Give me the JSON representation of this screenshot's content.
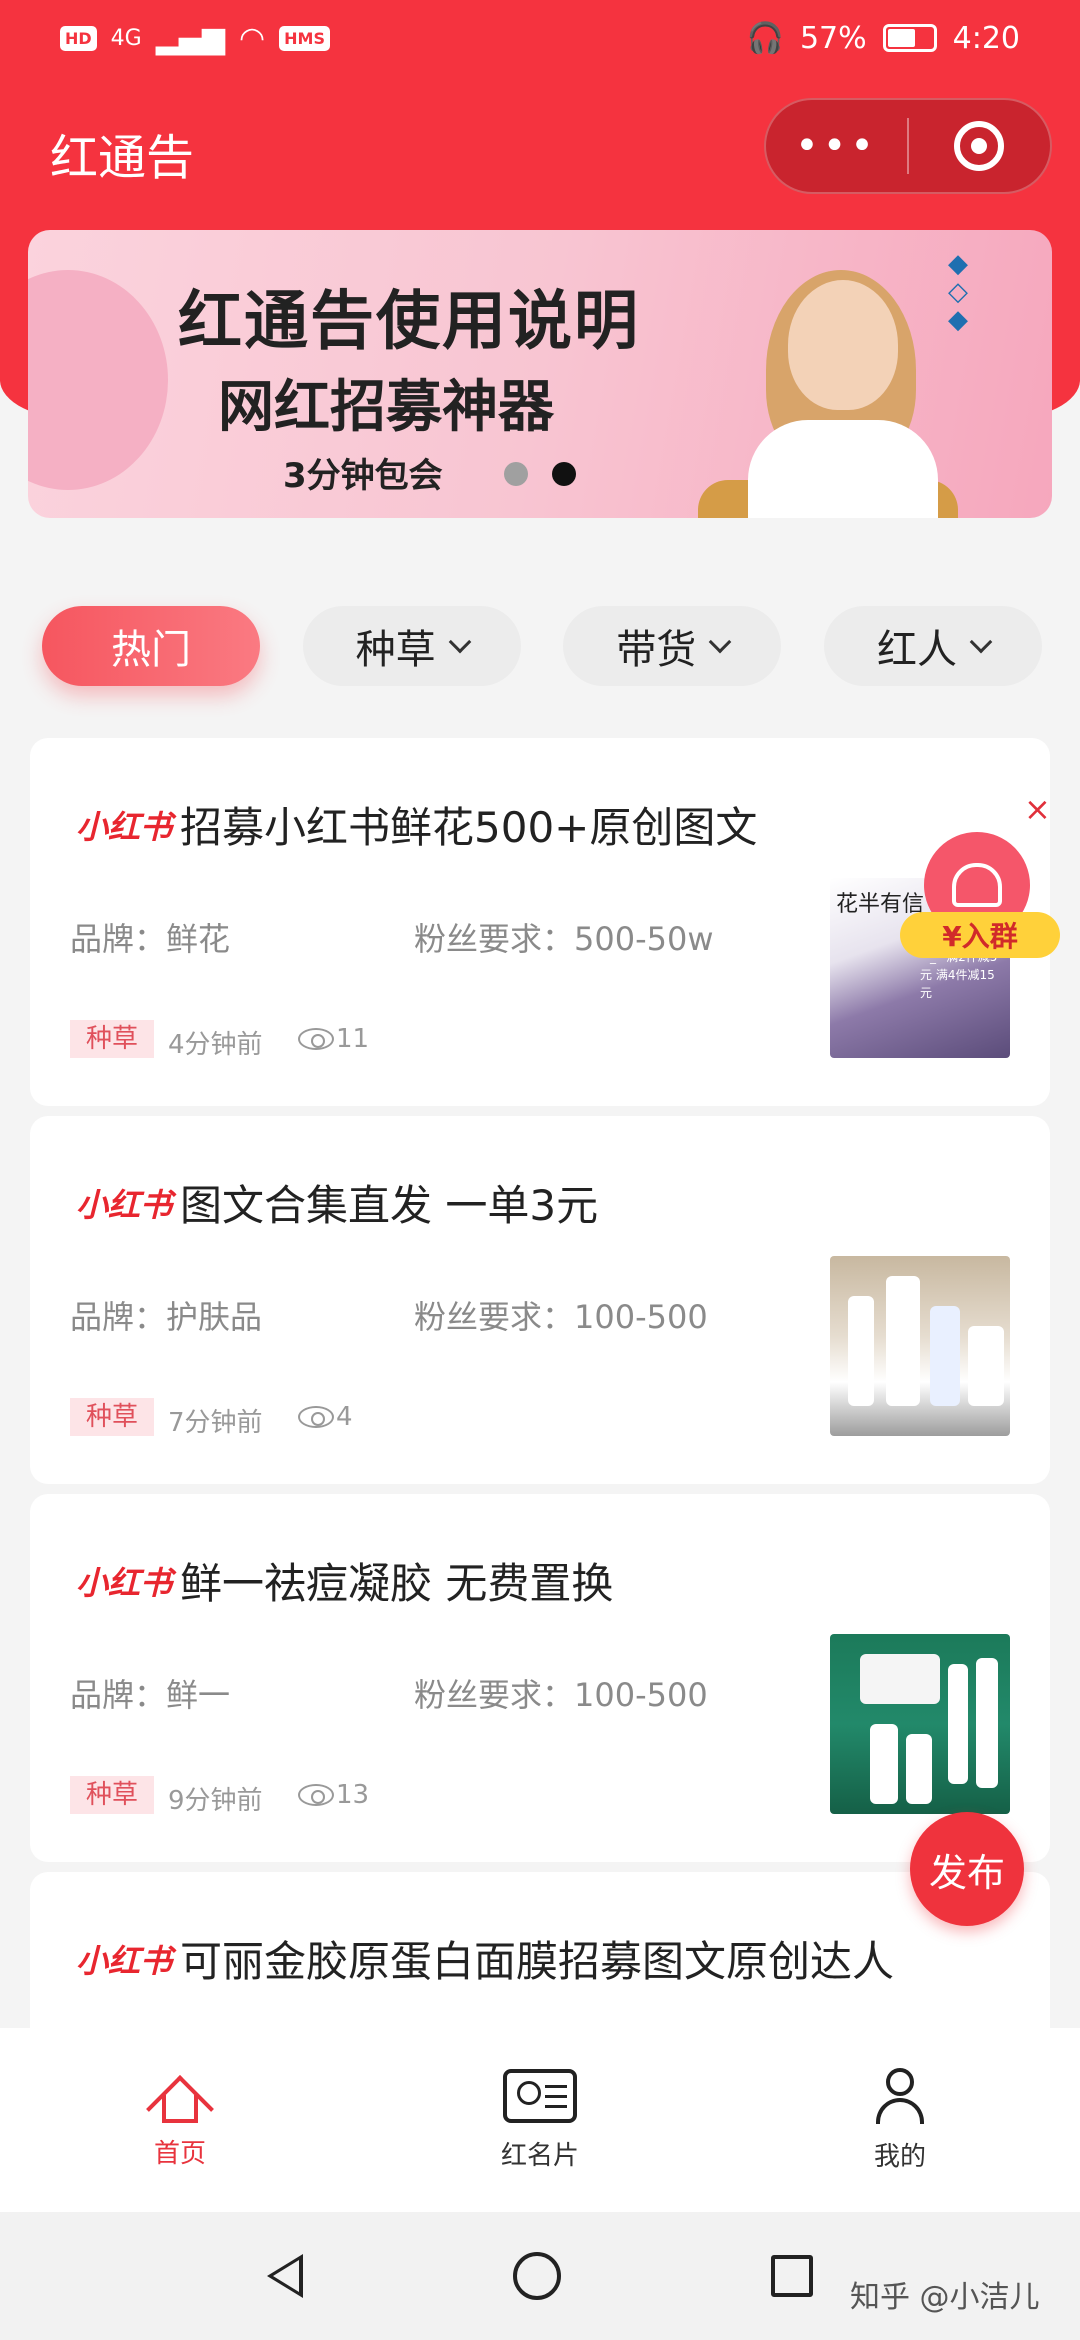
{
  "status_bar": {
    "left_icons": [
      "HD",
      "4G",
      "HMS"
    ],
    "battery": "57%",
    "time": "4:20"
  },
  "app": {
    "title": "红通告",
    "capsule_more": "•••"
  },
  "banner": {
    "title": "红通告使用说明",
    "subtitle": "网红招募神器",
    "tagline": "3分钟包会",
    "active_dot": 2,
    "dot_count": 2
  },
  "tabs": [
    {
      "label": "热门",
      "active": true
    },
    {
      "label": "种草",
      "active": false
    },
    {
      "label": "带货",
      "active": false
    },
    {
      "label": "红人",
      "active": false
    }
  ],
  "posts": [
    {
      "platform": "小红书",
      "title": "招募小红书鲜花500+原创图文",
      "brand": "品牌：鲜花",
      "fans": "粉丝要求：500-50w",
      "tag": "种草",
      "time": "4分钟前",
      "views": "11",
      "thumb_text": "花半有信",
      "thumb_caption": "^_^满2件减5元 满4件减15元"
    },
    {
      "platform": "小红书",
      "title": "图文合集直发 一单3元",
      "brand": "品牌：护肤品",
      "fans": "粉丝要求：100-500",
      "tag": "种草",
      "time": "7分钟前",
      "views": "4"
    },
    {
      "platform": "小红书",
      "title": "鲜一祛痘凝胶 无费置换",
      "brand": "品牌：鲜一",
      "fans": "粉丝要求：100-500",
      "tag": "种草",
      "time": "9分钟前",
      "views": "13"
    },
    {
      "platform": "小红书",
      "title": "可丽金胶原蛋白面膜招募图文原创达人"
    }
  ],
  "floating": {
    "close": "×",
    "join_group": "¥入群",
    "publish": "发布"
  },
  "tabbar": [
    {
      "label": "首页",
      "icon": "home-icon",
      "active": true
    },
    {
      "label": "红名片",
      "icon": "id-card-icon",
      "active": false
    },
    {
      "label": "我的",
      "icon": "profile-icon",
      "active": false
    }
  ],
  "watermark": "知乎 @小洁儿",
  "colors": {
    "primary": "#f5333f",
    "tag_text": "#e0505b",
    "tag_bg": "#fde4e7"
  }
}
